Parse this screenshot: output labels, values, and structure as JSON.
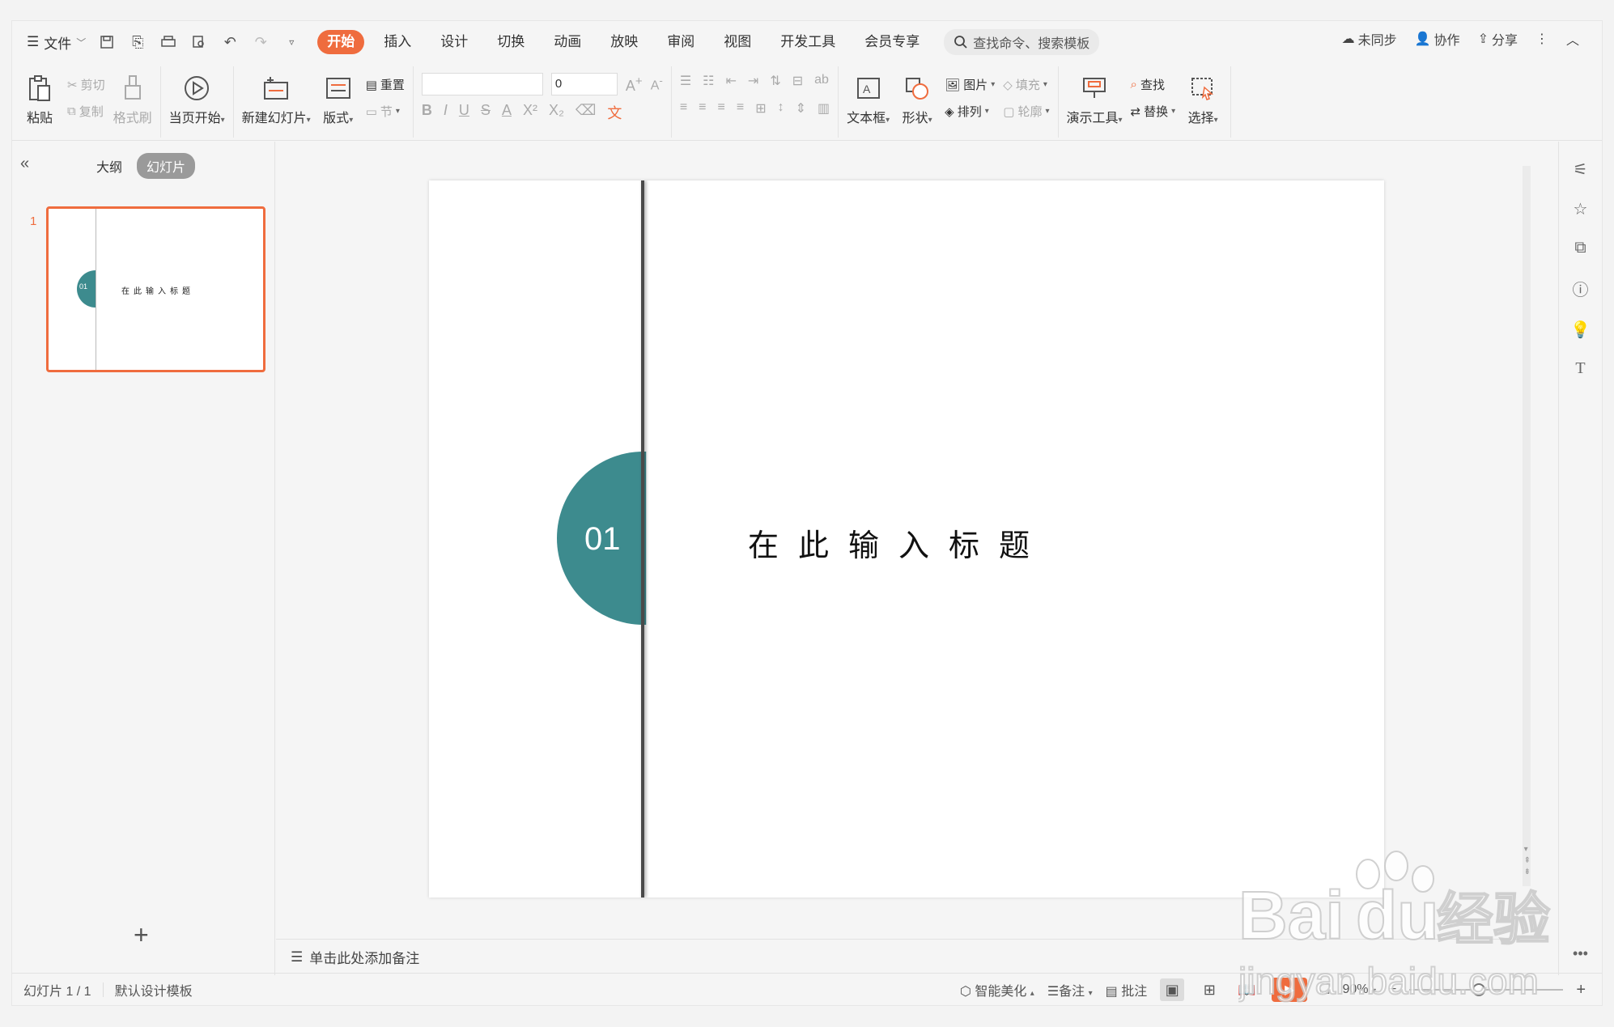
{
  "menubar": {
    "file_label": "文件",
    "tabs": [
      {
        "label": "开始",
        "active": true
      },
      {
        "label": "插入",
        "active": false
      },
      {
        "label": "设计",
        "active": false
      },
      {
        "label": "切换",
        "active": false
      },
      {
        "label": "动画",
        "active": false
      },
      {
        "label": "放映",
        "active": false
      },
      {
        "label": "审阅",
        "active": false
      },
      {
        "label": "视图",
        "active": false
      },
      {
        "label": "开发工具",
        "active": false
      },
      {
        "label": "会员专享",
        "active": false
      }
    ],
    "search_placeholder": "查找命令、搜索模板",
    "sync_label": "未同步",
    "collab_label": "协作",
    "share_label": "分享"
  },
  "ribbon": {
    "paste": "粘贴",
    "cut": "剪切",
    "copy": "复制",
    "format_painter": "格式刷",
    "from_current": "当页开始",
    "new_slide": "新建幻灯片",
    "layout": "版式",
    "reset": "重置",
    "section": "节",
    "font_size": "0",
    "textbox": "文本框",
    "shape": "形状",
    "picture": "图片",
    "fill": "填充",
    "arrange": "排列",
    "outline": "轮廓",
    "presenter_tools": "演示工具",
    "find": "查找",
    "replace": "替换",
    "select": "选择"
  },
  "leftpanel": {
    "outline_tab": "大纲",
    "slides_tab": "幻灯片",
    "thumb_number": "1"
  },
  "slide": {
    "number_badge": "01",
    "title": "在此输入标题",
    "accent_color": "#3d8b8e"
  },
  "notes": {
    "placeholder": "单击此处添加备注"
  },
  "statusbar": {
    "slide_counter": "幻灯片 1 / 1",
    "template": "默认设计模板",
    "beautify": "智能美化",
    "notes": "备注",
    "comments": "批注",
    "zoom": "90%"
  },
  "theme": {
    "accent": "#ef6c3e"
  }
}
